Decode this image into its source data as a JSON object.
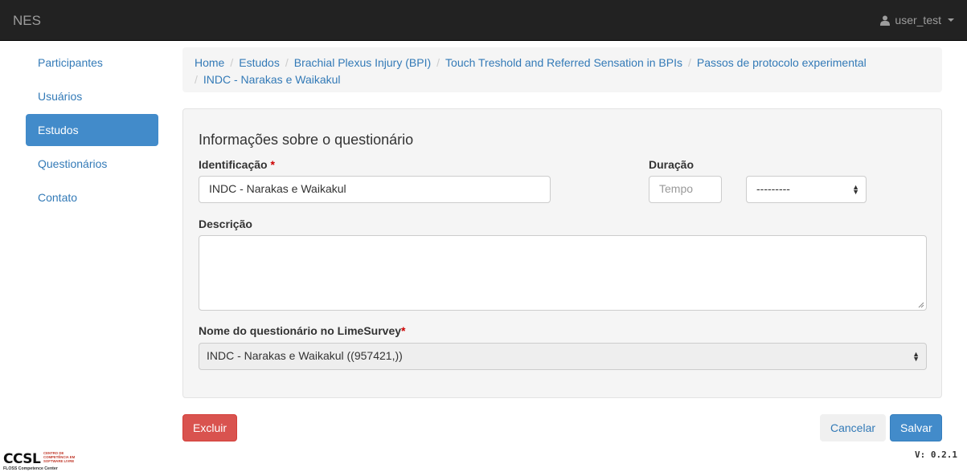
{
  "navbar": {
    "brand": "NES",
    "user": "user_test"
  },
  "sidebar": {
    "items": [
      {
        "label": "Participantes",
        "active": false
      },
      {
        "label": "Usuários",
        "active": false
      },
      {
        "label": "Estudos",
        "active": true
      },
      {
        "label": "Questionários",
        "active": false
      },
      {
        "label": "Contato",
        "active": false
      }
    ]
  },
  "breadcrumb": [
    "Home",
    "Estudos",
    "Brachial Plexus Injury (BPI)",
    "Touch Treshold and Referred Sensation in BPIs",
    "Passos de protocolo experimental",
    "INDC - Narakas e Waikakul"
  ],
  "form": {
    "title": "Informações sobre o questionário",
    "identification_label": "Identificação",
    "identification_value": "INDC - Narakas e Waikakul",
    "required_mark": "*",
    "duration_label": "Duração",
    "duration_placeholder": "Tempo",
    "duration_unit_value": "---------",
    "description_label": "Descrição",
    "description_value": "",
    "limesurvey_label": "Nome do questionário no LimeSurvey",
    "limesurvey_value": "INDC - Narakas e Waikakul ((957421,))"
  },
  "actions": {
    "delete": "Excluir",
    "cancel": "Cancelar",
    "save": "Salvar"
  },
  "footer": {
    "logo_text": "CCSL",
    "logo_tagline": "CENTRO DE COMPETÊNCIA EM SOFTWARE LIVRE",
    "logo_sub": "FLOSS Competence Center",
    "version": "V: 0.2.1"
  },
  "colors": {
    "navbar": "#222222",
    "active": "#428bca",
    "danger": "#d9534f",
    "link": "#337ab7"
  }
}
